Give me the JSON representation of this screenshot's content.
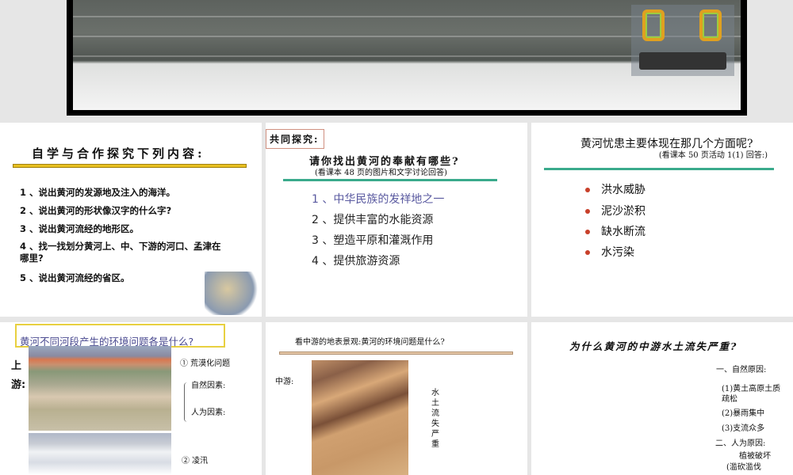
{
  "slide1": {
    "title": "自学与合作探究下列内容:",
    "items": [
      "1 、说出黄河的发源地及注入的海洋。",
      "2 、说出黄河的形状像汉字的什么字?",
      "3 、说出黄河流经的地形区。",
      "4 、找一找划分黄河上、中、下游的河口、孟津在哪里?",
      "5 、说出黄河流经的省区。"
    ]
  },
  "slide2": {
    "tag": "共同探究:",
    "title": "请你找出黄河的奉献有哪些?",
    "note": "(看课本 48 页的图片和文字讨论回答)",
    "items": [
      "1 、中华民族的发祥地之一",
      "2 、提供丰富的水能资源",
      "3 、塑造平原和灌溉作用",
      "4 、提供旅游资源"
    ]
  },
  "slide3": {
    "title": "黄河忧患主要体现在那几个方面呢?",
    "note": "(看课本 50 页活动 1(1) 回答:)",
    "items": [
      "洪水威胁",
      "泥沙淤积",
      "缺水断流",
      "水污染"
    ]
  },
  "slide4": {
    "title": "黄河不同河段产生的环境问题各是什么?",
    "label": "上游:",
    "p1": "① 荒漠化问题",
    "natural": "自然因素:",
    "human": "人为因素:",
    "p2": "② 凌汛"
  },
  "slide5": {
    "title": "看中游的地表景观:黄河的环境问题是什么?",
    "label": "中游:",
    "vertical": "水土流失严重"
  },
  "slide6": {
    "title": "为什么黄河的中游水土流失严重?",
    "lines": [
      "一、自然原因:",
      "(1)黄土高原土质疏松",
      "(2)暴雨集中",
      "(3)支流众多",
      "二、人为原因:",
      "植被破坏",
      "(滥砍滥伐"
    ]
  },
  "colors": {
    "yellow_rule": "#e8c020",
    "teal_rule": "#3aaa8c",
    "tan_rule": "#c9a57a",
    "bullet": "#c8402a",
    "accent_text": "#5a5aa0"
  }
}
